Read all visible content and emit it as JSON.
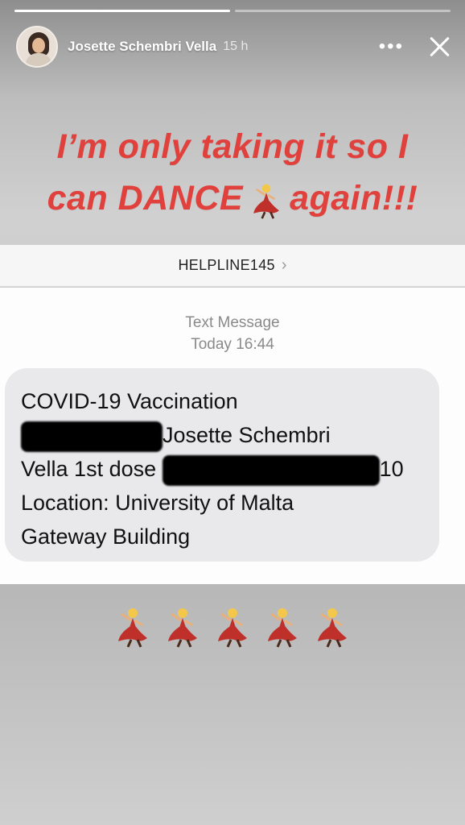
{
  "story": {
    "progress": [
      1.0,
      0.0
    ],
    "user": {
      "name": "Josette Schembri Vella",
      "time": "15 h"
    },
    "more_label": "•••",
    "caption": {
      "line1": "I’m only taking it so I",
      "line2_before": "can DANCE",
      "line2_after": "again!!!"
    }
  },
  "message": {
    "sender": "HELPLINE145",
    "chevron": "›",
    "meta_type": "Text Message",
    "meta_time": "Today 16:44",
    "bubble": {
      "line1": "COVID-19 Vaccination",
      "line2": "Josette Schembri",
      "line3_a": "Vella 1st dose",
      "line3_b": "10",
      "line4": "Location: University of Malta",
      "line5": "Gateway Building"
    }
  },
  "icons": {
    "dancer": "dancer-emoji",
    "colors": {
      "caption": "#e0413c",
      "dress": "#c0302a"
    }
  }
}
